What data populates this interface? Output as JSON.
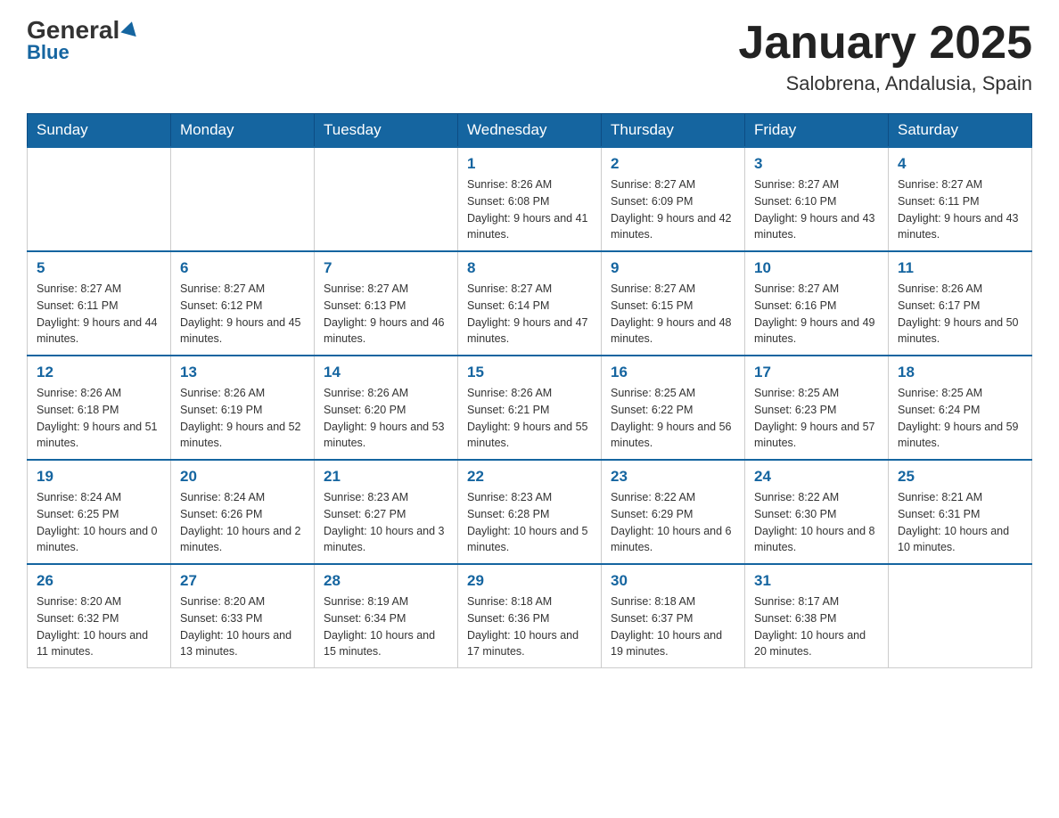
{
  "header": {
    "logo_general": "General",
    "logo_blue": "Blue",
    "month_title": "January 2025",
    "subtitle": "Salobrena, Andalusia, Spain"
  },
  "days_of_week": [
    "Sunday",
    "Monday",
    "Tuesday",
    "Wednesday",
    "Thursday",
    "Friday",
    "Saturday"
  ],
  "weeks": [
    [
      null,
      null,
      null,
      {
        "day": 1,
        "sunrise": "8:26 AM",
        "sunset": "6:08 PM",
        "daylight": "9 hours and 41 minutes."
      },
      {
        "day": 2,
        "sunrise": "8:27 AM",
        "sunset": "6:09 PM",
        "daylight": "9 hours and 42 minutes."
      },
      {
        "day": 3,
        "sunrise": "8:27 AM",
        "sunset": "6:10 PM",
        "daylight": "9 hours and 43 minutes."
      },
      {
        "day": 4,
        "sunrise": "8:27 AM",
        "sunset": "6:11 PM",
        "daylight": "9 hours and 43 minutes."
      }
    ],
    [
      {
        "day": 5,
        "sunrise": "8:27 AM",
        "sunset": "6:11 PM",
        "daylight": "9 hours and 44 minutes."
      },
      {
        "day": 6,
        "sunrise": "8:27 AM",
        "sunset": "6:12 PM",
        "daylight": "9 hours and 45 minutes."
      },
      {
        "day": 7,
        "sunrise": "8:27 AM",
        "sunset": "6:13 PM",
        "daylight": "9 hours and 46 minutes."
      },
      {
        "day": 8,
        "sunrise": "8:27 AM",
        "sunset": "6:14 PM",
        "daylight": "9 hours and 47 minutes."
      },
      {
        "day": 9,
        "sunrise": "8:27 AM",
        "sunset": "6:15 PM",
        "daylight": "9 hours and 48 minutes."
      },
      {
        "day": 10,
        "sunrise": "8:27 AM",
        "sunset": "6:16 PM",
        "daylight": "9 hours and 49 minutes."
      },
      {
        "day": 11,
        "sunrise": "8:26 AM",
        "sunset": "6:17 PM",
        "daylight": "9 hours and 50 minutes."
      }
    ],
    [
      {
        "day": 12,
        "sunrise": "8:26 AM",
        "sunset": "6:18 PM",
        "daylight": "9 hours and 51 minutes."
      },
      {
        "day": 13,
        "sunrise": "8:26 AM",
        "sunset": "6:19 PM",
        "daylight": "9 hours and 52 minutes."
      },
      {
        "day": 14,
        "sunrise": "8:26 AM",
        "sunset": "6:20 PM",
        "daylight": "9 hours and 53 minutes."
      },
      {
        "day": 15,
        "sunrise": "8:26 AM",
        "sunset": "6:21 PM",
        "daylight": "9 hours and 55 minutes."
      },
      {
        "day": 16,
        "sunrise": "8:25 AM",
        "sunset": "6:22 PM",
        "daylight": "9 hours and 56 minutes."
      },
      {
        "day": 17,
        "sunrise": "8:25 AM",
        "sunset": "6:23 PM",
        "daylight": "9 hours and 57 minutes."
      },
      {
        "day": 18,
        "sunrise": "8:25 AM",
        "sunset": "6:24 PM",
        "daylight": "9 hours and 59 minutes."
      }
    ],
    [
      {
        "day": 19,
        "sunrise": "8:24 AM",
        "sunset": "6:25 PM",
        "daylight": "10 hours and 0 minutes."
      },
      {
        "day": 20,
        "sunrise": "8:24 AM",
        "sunset": "6:26 PM",
        "daylight": "10 hours and 2 minutes."
      },
      {
        "day": 21,
        "sunrise": "8:23 AM",
        "sunset": "6:27 PM",
        "daylight": "10 hours and 3 minutes."
      },
      {
        "day": 22,
        "sunrise": "8:23 AM",
        "sunset": "6:28 PM",
        "daylight": "10 hours and 5 minutes."
      },
      {
        "day": 23,
        "sunrise": "8:22 AM",
        "sunset": "6:29 PM",
        "daylight": "10 hours and 6 minutes."
      },
      {
        "day": 24,
        "sunrise": "8:22 AM",
        "sunset": "6:30 PM",
        "daylight": "10 hours and 8 minutes."
      },
      {
        "day": 25,
        "sunrise": "8:21 AM",
        "sunset": "6:31 PM",
        "daylight": "10 hours and 10 minutes."
      }
    ],
    [
      {
        "day": 26,
        "sunrise": "8:20 AM",
        "sunset": "6:32 PM",
        "daylight": "10 hours and 11 minutes."
      },
      {
        "day": 27,
        "sunrise": "8:20 AM",
        "sunset": "6:33 PM",
        "daylight": "10 hours and 13 minutes."
      },
      {
        "day": 28,
        "sunrise": "8:19 AM",
        "sunset": "6:34 PM",
        "daylight": "10 hours and 15 minutes."
      },
      {
        "day": 29,
        "sunrise": "8:18 AM",
        "sunset": "6:36 PM",
        "daylight": "10 hours and 17 minutes."
      },
      {
        "day": 30,
        "sunrise": "8:18 AM",
        "sunset": "6:37 PM",
        "daylight": "10 hours and 19 minutes."
      },
      {
        "day": 31,
        "sunrise": "8:17 AM",
        "sunset": "6:38 PM",
        "daylight": "10 hours and 20 minutes."
      },
      null
    ]
  ]
}
